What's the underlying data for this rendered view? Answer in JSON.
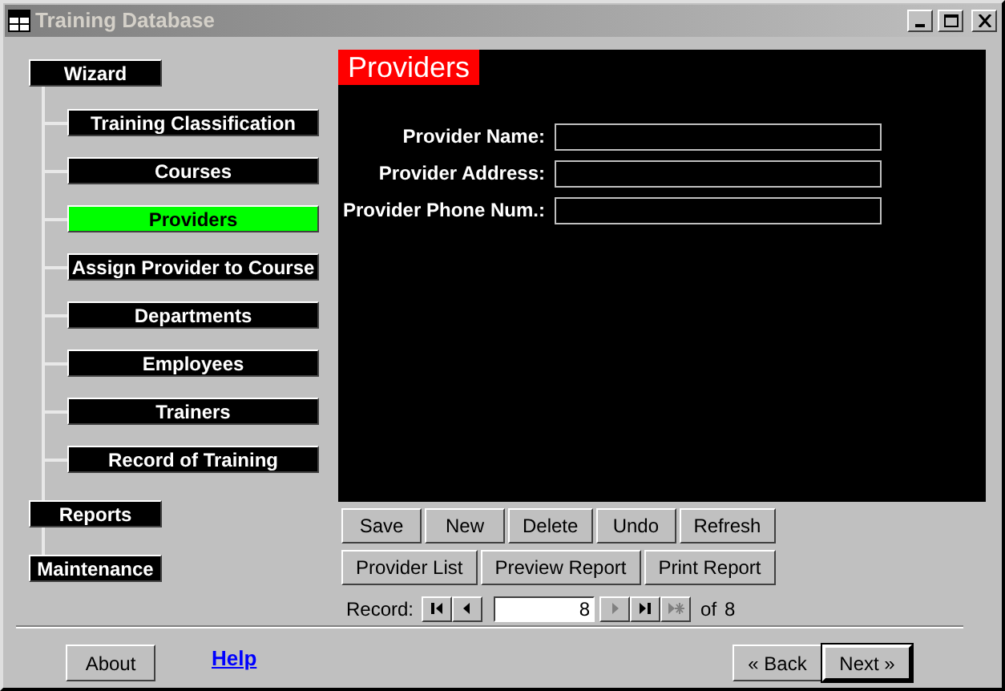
{
  "window": {
    "title": "Training Database"
  },
  "nav": [
    {
      "label": "Wizard",
      "selected": false,
      "children": [
        {
          "label": "Training Classification",
          "selected": false
        },
        {
          "label": "Courses",
          "selected": false
        },
        {
          "label": "Providers",
          "selected": true
        },
        {
          "label": "Assign Provider to Course",
          "selected": false
        },
        {
          "label": "Departments",
          "selected": false
        },
        {
          "label": "Employees",
          "selected": false
        },
        {
          "label": "Trainers",
          "selected": false
        },
        {
          "label": "Record of Training",
          "selected": false
        }
      ]
    },
    {
      "label": "Reports",
      "selected": false
    },
    {
      "label": "Maintenance",
      "selected": false
    }
  ],
  "form": {
    "title": "Providers",
    "fields": [
      {
        "label": "Provider Name:"
      },
      {
        "label": "Provider Address:"
      },
      {
        "label": "Provider Phone Num.:"
      }
    ]
  },
  "action_rows": [
    [
      "Save",
      "New",
      "Delete",
      "Undo",
      "Refresh"
    ],
    [
      "Provider List",
      "Preview Report",
      "Print Report"
    ]
  ],
  "record_nav": {
    "label": "Record:",
    "value": "8",
    "of_label": "of",
    "total": "8",
    "buttons": [
      {
        "kind": "first",
        "disabled": false
      },
      {
        "kind": "prev",
        "disabled": false
      },
      {
        "kind": "next",
        "disabled": true
      },
      {
        "kind": "last",
        "disabled": false
      },
      {
        "kind": "new",
        "disabled": true
      }
    ]
  },
  "footer": {
    "about": "About",
    "help": "Help",
    "buttons": [
      {
        "label": "« Back",
        "default": false
      },
      {
        "label": "Next »",
        "default": true
      }
    ]
  }
}
